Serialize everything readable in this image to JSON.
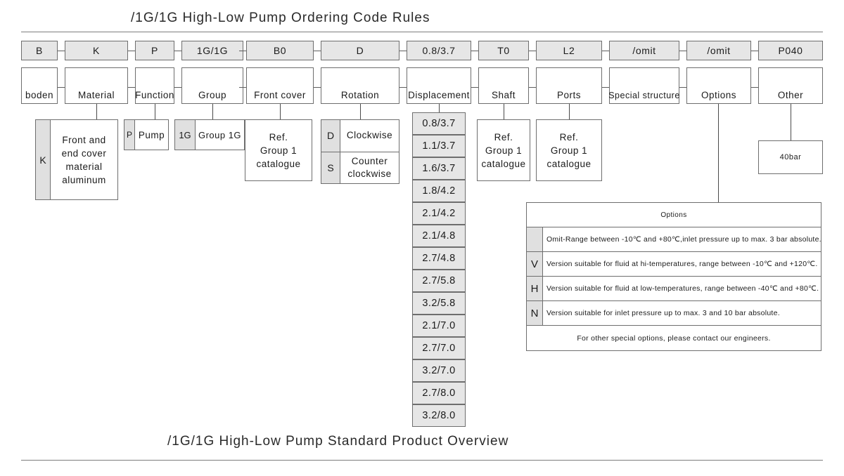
{
  "title_top": "/1G/1G High-Low Pump Ordering Code Rules",
  "title_bottom": "/1G/1G High-Low Pump Standard Product Overview",
  "colors": {
    "code_fill": "#e6e6e6",
    "key_fill": "#e0e0e0",
    "border": "#6e6e6e",
    "rule": "#7d7d7d",
    "text": "#1b1b1b"
  },
  "columns": [
    {
      "code": "B",
      "label": "boden"
    },
    {
      "code": "K",
      "label": "Material"
    },
    {
      "code": "P",
      "label": "Function"
    },
    {
      "code": "1G/1G",
      "label": "Group"
    },
    {
      "code": "B0",
      "label": "Front cover"
    },
    {
      "code": "D",
      "label": "Rotation"
    },
    {
      "code": "0.8/3.7",
      "label": "Displacement"
    },
    {
      "code": "T0",
      "label": "Shaft"
    },
    {
      "code": "L2",
      "label": "Ports"
    },
    {
      "code": "/omit",
      "label": "Special structure"
    },
    {
      "code": "/omit",
      "label": "Options"
    },
    {
      "code": "P040",
      "label": "Other"
    }
  ],
  "details": {
    "material": {
      "key": "K",
      "value": "Front and\nend cover\nmaterial\naluminum"
    },
    "function": {
      "key": "P",
      "value": "Pump"
    },
    "group": {
      "key": "1G",
      "value": "Group 1G"
    },
    "front_cover": {
      "value": "Ref.\nGroup 1\ncatalogue"
    },
    "rotation": [
      {
        "key": "D",
        "value": "Clockwise"
      },
      {
        "key": "S",
        "value": "Counter\nclockwise"
      }
    ],
    "shaft": {
      "value": "Ref.\nGroup 1\ncatalogue"
    },
    "ports": {
      "value": "Ref.\nGroup 1\ncatalogue"
    },
    "other": {
      "value": "40bar"
    }
  },
  "displacement": {
    "values": [
      "0.8/3.7",
      "1.1/3.7",
      "1.6/3.7",
      "1.8/4.2",
      "2.1/4.2",
      "2.1/4.8",
      "2.7/4.8",
      "2.7/5.8",
      "3.2/5.8",
      "2.1/7.0",
      "2.7/7.0",
      "3.2/7.0",
      "2.7/8.0",
      "3.2/8.0"
    ]
  },
  "options_table": {
    "header": "Options",
    "rows": [
      {
        "key": "",
        "text": "Omit-Range between -10℃ and +80℃,inlet pressure up to max. 3 bar absolute."
      },
      {
        "key": "V",
        "text": "Version suitable for fluid at hi-temperatures, range between -10℃ and +120℃."
      },
      {
        "key": "H",
        "text": "Version suitable for fluid at low-temperatures, range between -40℃ and +80℃."
      },
      {
        "key": "N",
        "text": "Version suitable for inlet pressure up to max. 3 and 10 bar absolute."
      }
    ],
    "footer": "For other special options, please contact our engineers."
  }
}
